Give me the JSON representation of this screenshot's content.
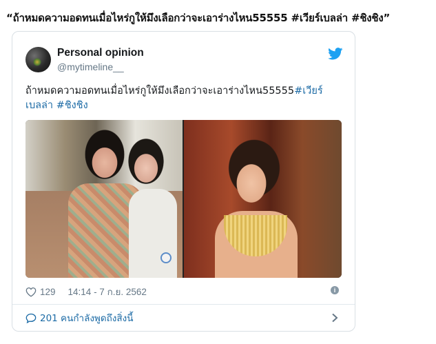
{
  "caption": "“ถ้าหมดความอดทนเมื่อไหร่กูให้มึงเลือกว่าจะเอาร่างไหน55555 #เวียร์เบลล่า #ชิงชิง”",
  "tweet": {
    "display_name": "Personal opinion",
    "handle": "@mytimeline__",
    "text_plain": "ถ้าหมดความอดทนเมื่อไหร่กูให้มึงเลือกว่าจะเอาร่างไหน55555",
    "hashtag_1_part1": "#เวียร์",
    "hashtag_1_part2": "เบลล่า",
    "hashtag_2": "#ชิงชิง",
    "likes": "129",
    "timestamp": "14:14 - 7 ก.ย. 2562",
    "replies_text": "201 คนกำลังพูดถึงสิ่งนี้"
  },
  "icons": {
    "twitter": "twitter-bird-icon",
    "like": "heart-icon",
    "info": "info-icon",
    "reply": "speech-bubble-icon",
    "more": "chevron-right-icon"
  },
  "colors": {
    "twitter_blue": "#1da1f2",
    "hashtag": "#1b6aa5",
    "muted": "#657786"
  }
}
